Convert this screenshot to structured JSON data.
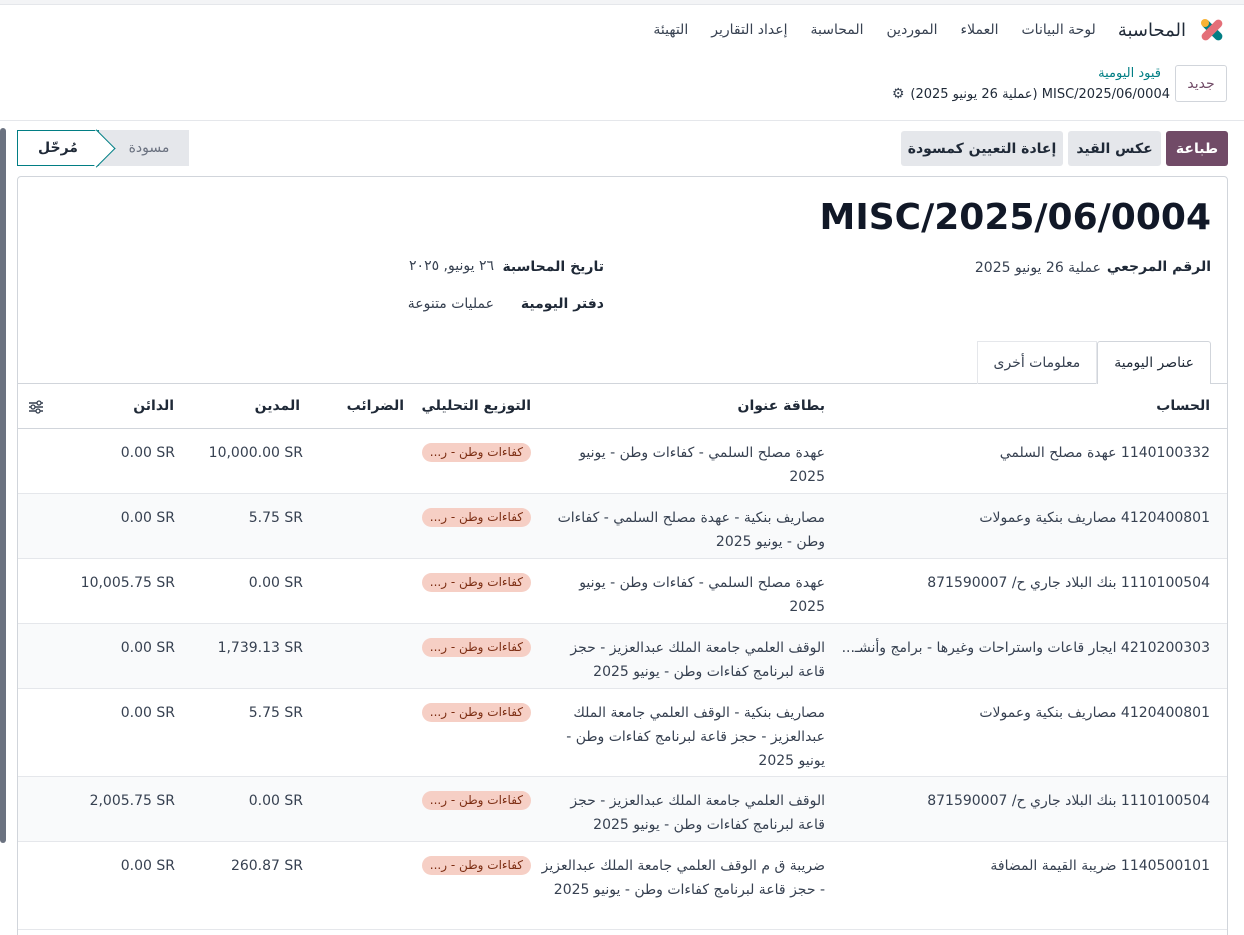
{
  "app": {
    "title": "المحاسبة"
  },
  "nav": [
    "لوحة البيانات",
    "العملاء",
    "الموردين",
    "المحاسبة",
    "إعداد التقارير",
    "التهيئة"
  ],
  "control": {
    "new_label": "جديد",
    "breadcrumb_parent": "قيود اليومية",
    "breadcrumb_current": "MISC/2025/06/0004 (عملية 26 يونيو 2025)"
  },
  "actions": {
    "print": "طباعة",
    "reverse": "عكس القيد",
    "reset": "إعادة التعيين كمسودة"
  },
  "status": {
    "draft": "مسودة",
    "posted": "مُرحّل"
  },
  "move": {
    "name": "MISC/2025/06/0004",
    "ref_label": "الرقم المرجعي",
    "ref_value": "عملية 26 يونيو 2025",
    "date_label": "تاريخ المحاسبة",
    "date_value": "٢٦ يونيو, ٢٠٢٥",
    "journal_label": "دفتر اليومية",
    "journal_value": "عمليات متنوعة"
  },
  "tabs": {
    "items": "عناصر اليومية",
    "other": "معلومات أخرى"
  },
  "table": {
    "headers": {
      "account": "الحساب",
      "label": "بطاقة عنوان",
      "analytic": "التوزيع التحليلي",
      "taxes": "الضرائب",
      "debit": "المدين",
      "credit": "الدائن"
    },
    "rows": [
      {
        "account": "1140100332 عهدة مصلح السلمي",
        "label": "عهدة مصلح السلمي - كفاءات وطن - يونيو 2025",
        "tag": "كفاءات وطن - ر...",
        "debit": "10,000.00 SR",
        "credit": "0.00 SR"
      },
      {
        "account": "4120400801 مصاريف بنكية وعمولات",
        "label": "مصاريف بنكية - عهدة مصلح السلمي - كفاءات وطن - يونيو 2025",
        "tag": "كفاءات وطن - ر...",
        "debit": "5.75 SR",
        "credit": "0.00 SR"
      },
      {
        "account": "1110100504 بنك البلاد جاري ح/ 871590007",
        "label": "عهدة مصلح السلمي - كفاءات وطن - يونيو 2025",
        "tag": "كفاءات وطن - ر...",
        "debit": "0.00 SR",
        "credit": "10,005.75 SR"
      },
      {
        "account": "4210200303 ايجار قاعات واستراحات وغيرها - برامج وأنشـ...",
        "label": "الوقف العلمي جامعة الملك عبدالعزيز - حجز قاعة لبرنامج كفاءات وطن - يونيو 2025",
        "tag": "كفاءات وطن - ر...",
        "debit": "1,739.13 SR",
        "credit": "0.00 SR"
      },
      {
        "account": "4120400801 مصاريف بنكية وعمولات",
        "label": "مصاريف بنكية - الوقف العلمي جامعة الملك عبدالعزيز - حجز قاعة لبرنامج كفاءات وطن - يونيو 2025",
        "tag": "كفاءات وطن - ر...",
        "debit": "5.75 SR",
        "credit": "0.00 SR"
      },
      {
        "account": "1110100504 بنك البلاد جاري ح/ 871590007",
        "label": "الوقف العلمي جامعة الملك عبدالعزيز - حجز قاعة لبرنامج كفاءات وطن - يونيو 2025",
        "tag": "كفاءات وطن - ر...",
        "debit": "0.00 SR",
        "credit": "2,005.75 SR"
      },
      {
        "account": "1140500101 ضريبة القيمة المضافة",
        "label": "ضريبة ق م الوقف العلمي جامعة الملك عبدالعزيز - حجز قاعة لبرنامج كفاءات وطن - يونيو 2025",
        "tag": "كفاءات وطن - ر...",
        "debit": "260.87 SR",
        "credit": "0.00 SR"
      }
    ]
  },
  "colors": {
    "primary": "#714b67",
    "accent": "#017e84",
    "tag_bg": "#f6cfc5"
  },
  "icons": {
    "logo": "odoo-accounting-logo",
    "gear": "gear-icon",
    "settings": "optional-columns-icon"
  }
}
